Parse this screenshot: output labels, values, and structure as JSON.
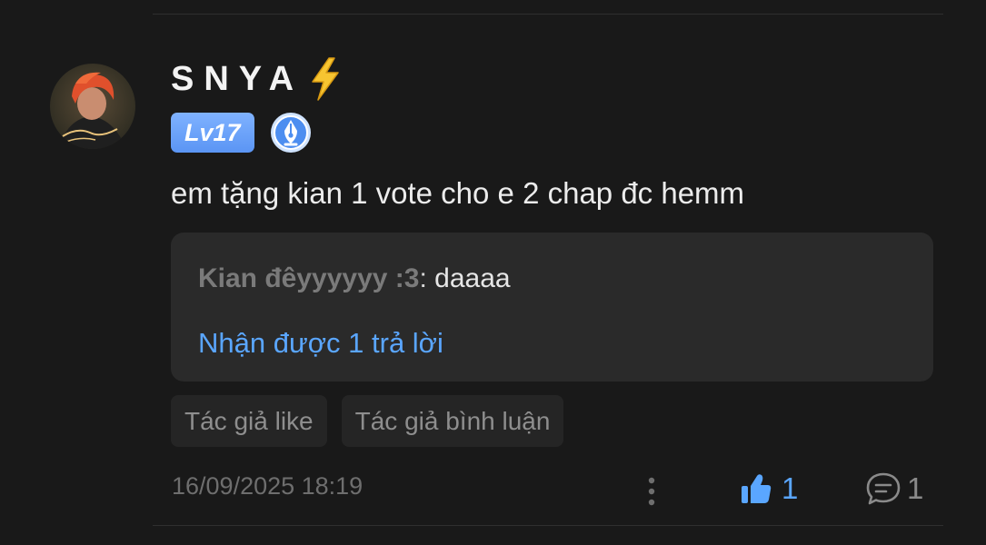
{
  "comment": {
    "user": {
      "name": "SNYA",
      "level": "Lv17",
      "avatar_icon": "avatar-icon",
      "name_emoji_icon": "lightning-bolt-icon",
      "badge_icon": "pen-nib-badge-icon"
    },
    "text": "em tặng kian 1 vote cho e 2 chap đc hemm",
    "quote": {
      "author": "Kian đêyyyyyy :3",
      "separator": ":",
      "text": " daaaa",
      "replies_label": "Nhận được 1 trả lời"
    },
    "tags": [
      "Tác giả like",
      "Tác giả bình luận"
    ],
    "timestamp": "16/09/2025 18:19",
    "likes": "1",
    "comments": "1"
  },
  "colors": {
    "background": "#191919",
    "accent": "#5aa6ff",
    "quote_background": "#2a2a2a",
    "level_badge": "#6aa3fb",
    "bolt": "#f7c531"
  }
}
